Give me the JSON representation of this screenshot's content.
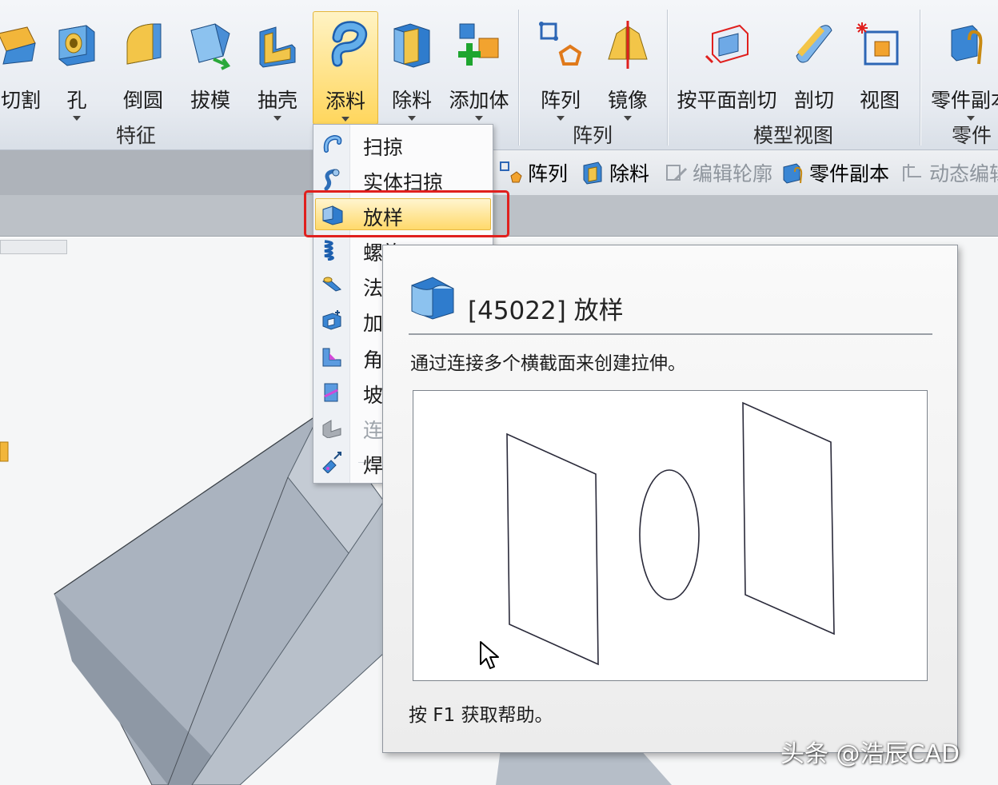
{
  "ribbon": {
    "buttons": {
      "cut": "切割",
      "hole": "孔",
      "round": "倒圆",
      "draft": "拔模",
      "shell": "抽壳",
      "add": "添料",
      "remove": "除料",
      "add_body": "添加体",
      "pattern": "阵列",
      "mirror": "镜像",
      "plane_section": "按平面剖切",
      "section": "剖切",
      "view": "视图",
      "part_copy": "零件副本"
    },
    "groups": {
      "features": "特征",
      "pattern": "阵列",
      "model_view": "模型视图",
      "parts": "零件"
    },
    "active_button": "添料",
    "active_color": "#ffd65c"
  },
  "toolbar2": {
    "pattern": "阵列",
    "remove": "除料",
    "edit_profile": "编辑轮廓",
    "part_copy": "零件副本",
    "dynamic_edit": "动态编辑"
  },
  "dropdown": {
    "items": [
      {
        "label": "扫掠",
        "icon": "sweep-icon"
      },
      {
        "label": "实体扫掠",
        "icon": "solid-sweep-icon"
      },
      {
        "label": "放样",
        "icon": "loft-icon",
        "highlighted": true
      },
      {
        "label": "螺旋",
        "icon": "helix-icon"
      },
      {
        "label": "法",
        "icon": "normal-icon"
      },
      {
        "label": "加",
        "icon": "thicken-icon"
      },
      {
        "label": "角",
        "icon": "rib-icon"
      },
      {
        "label": "坡",
        "icon": "lip-icon"
      },
      {
        "label": "连",
        "icon": "web-icon",
        "disabled": true
      },
      {
        "label": "焊",
        "icon": "weld-icon"
      }
    ],
    "highlight_outline_color": "#e0201e"
  },
  "tooltip": {
    "title": "[45022] 放样",
    "description": "通过连接多个横截面来创建拉伸。",
    "help_hint": "按 F1 获取帮助。"
  },
  "watermark": "头条 @浩辰CAD"
}
